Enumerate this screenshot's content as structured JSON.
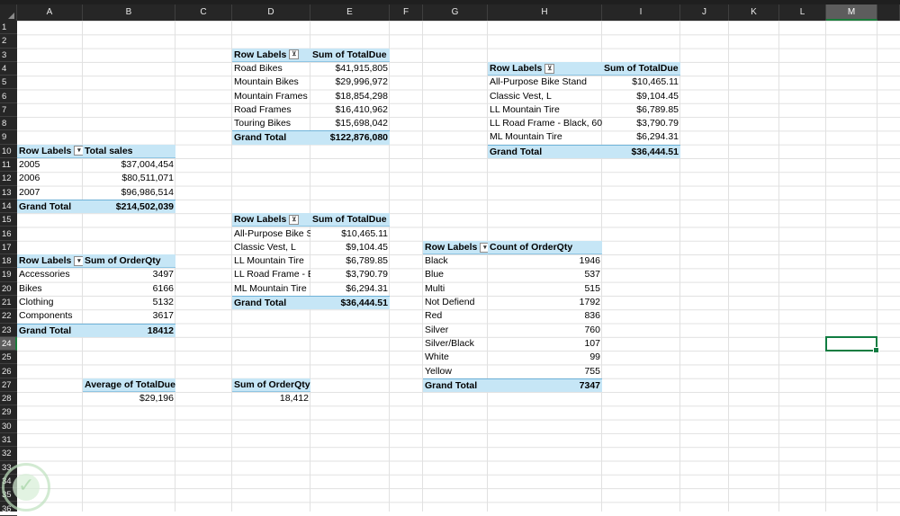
{
  "columns": [
    "A",
    "B",
    "C",
    "D",
    "E",
    "F",
    "G",
    "H",
    "I",
    "J",
    "K",
    "L",
    "M"
  ],
  "rows": [
    "1",
    "2",
    "3",
    "4",
    "5",
    "6",
    "7",
    "8",
    "9",
    "10",
    "11",
    "12",
    "13",
    "14",
    "15",
    "16",
    "17",
    "18",
    "19",
    "20",
    "21",
    "22",
    "23",
    "24",
    "25",
    "26",
    "27",
    "28",
    "29",
    "30",
    "31",
    "32",
    "33",
    "34",
    "35",
    "36"
  ],
  "selected_cell": {
    "column": "M",
    "row": "24"
  },
  "pivot_road": {
    "header_label": "Row Labels",
    "header_value": "Sum of TotalDue",
    "rows": [
      {
        "label": "Road Bikes",
        "value": "$41,915,805"
      },
      {
        "label": "Mountain Bikes",
        "value": "$29,996,972"
      },
      {
        "label": "Mountain Frames",
        "value": "$18,854,298"
      },
      {
        "label": "Road Frames",
        "value": "$16,410,962"
      },
      {
        "label": "Touring Bikes",
        "value": "$15,698,042"
      }
    ],
    "total_label": "Grand Total",
    "total_value": "$122,876,080"
  },
  "pivot_products": {
    "header_label": "Row Labels",
    "header_value": "Sum of TotalDue",
    "rows": [
      {
        "label": "All-Purpose Bike Stand",
        "value": "$10,465.11"
      },
      {
        "label": "Classic Vest, L",
        "value": "$9,104.45"
      },
      {
        "label": "LL Mountain Tire",
        "value": "$6,789.85"
      },
      {
        "label": "LL Road Frame - Black, 60",
        "value": "$3,790.79"
      },
      {
        "label": "ML Mountain Tire",
        "value": "$6,294.31"
      }
    ],
    "total_label": "Grand Total",
    "total_value": "$36,444.51"
  },
  "pivot_products_2": {
    "header_label": "Row Labels",
    "header_value": "Sum of TotalDue",
    "rows": [
      {
        "label": "All-Purpose Bike S",
        "value": "$10,465.11"
      },
      {
        "label": "Classic Vest, L",
        "value": "$9,104.45"
      },
      {
        "label": "LL Mountain Tire",
        "value": "$6,789.85"
      },
      {
        "label": "LL Road Frame - Bl",
        "value": "$3,790.79"
      },
      {
        "label": "ML Mountain Tire",
        "value": "$6,294.31"
      }
    ],
    "total_label": "Grand Total",
    "total_value": "$36,444.51"
  },
  "pivot_years": {
    "header_label": "Row Labels",
    "header_value": "Total sales",
    "rows": [
      {
        "label": "2005",
        "value": "$37,004,454"
      },
      {
        "label": "2006",
        "value": "$80,511,071"
      },
      {
        "label": "2007",
        "value": "$96,986,514"
      }
    ],
    "total_label": "Grand Total",
    "total_value": "$214,502,039"
  },
  "pivot_categories": {
    "header_label": "Row Labels",
    "header_value": "Sum of OrderQty",
    "rows": [
      {
        "label": "Accessories",
        "value": "3497"
      },
      {
        "label": "Bikes",
        "value": "6166"
      },
      {
        "label": "Clothing",
        "value": "5132"
      },
      {
        "label": "Components",
        "value": "3617"
      }
    ],
    "total_label": "Grand Total",
    "total_value": "18412"
  },
  "pivot_colors": {
    "header_label": "Row Labels",
    "header_value": "Count of OrderQty",
    "rows": [
      {
        "label": "Black",
        "value": "1946"
      },
      {
        "label": "Blue",
        "value": "537"
      },
      {
        "label": "Multi",
        "value": "515"
      },
      {
        "label": "Not Defiend",
        "value": "1792"
      },
      {
        "label": "Red",
        "value": "836"
      },
      {
        "label": "Silver",
        "value": "760"
      },
      {
        "label": "Silver/Black",
        "value": "107"
      },
      {
        "label": "White",
        "value": "99"
      },
      {
        "label": "Yellow",
        "value": "755"
      }
    ],
    "total_label": "Grand Total",
    "total_value": "7347"
  },
  "pivot_avg": {
    "header": "Average of TotalDue",
    "value": "$29,196"
  },
  "pivot_qty": {
    "header": "Sum of OrderQty",
    "value": "18,412"
  },
  "colors": {
    "pivot_header": "#c6e6f6",
    "selection": "#107c41",
    "header_bg": "#262626"
  },
  "icons": {
    "filter_dropdown": "filter-dropdown-icon",
    "watermark": "watermark-logo"
  }
}
